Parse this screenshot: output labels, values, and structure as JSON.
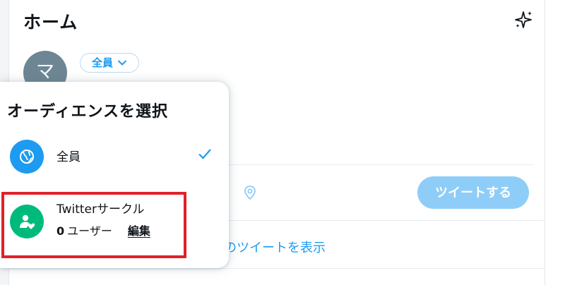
{
  "header": {
    "title": "ホーム",
    "sparkle_icon": "sparkle-icon"
  },
  "compose": {
    "avatar_initial": "マ",
    "audience_label": "全員",
    "tweet_button": "ツイートする"
  },
  "timeline": {
    "show_more": "件のツイートを表示"
  },
  "audience_popover": {
    "title": "オーディエンスを選択",
    "options": [
      {
        "label": "全員",
        "icon": "globe-icon",
        "selected": true
      },
      {
        "label": "Twitterサークル",
        "icon": "circle-people-icon",
        "count": "0",
        "count_label": "ユーザー",
        "edit_label": "編集"
      }
    ]
  },
  "colors": {
    "accent": "#1d9bf0",
    "circle_green": "#00ba7c",
    "tweet_button_disabled": "#8ecdf8",
    "highlight_red": "#e0212a"
  }
}
